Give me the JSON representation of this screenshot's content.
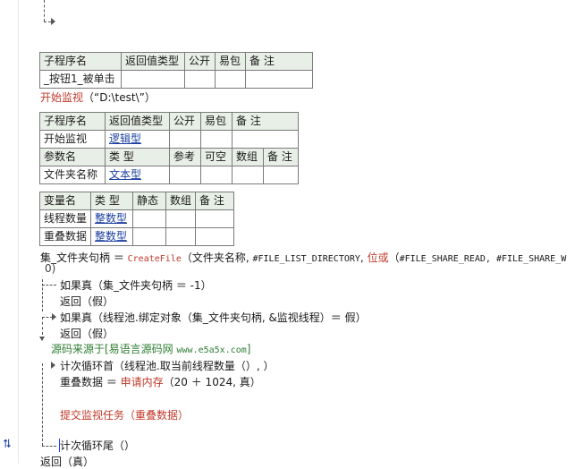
{
  "sub1_table": {
    "headers": [
      "子程序名",
      "返回值类型",
      "公开",
      "易包",
      "备 注"
    ],
    "row": [
      "_按钮1_被单击",
      "",
      "",
      "",
      ""
    ]
  },
  "call_line": {
    "func": "开始监视",
    "args": "（“D:\\test\\”）"
  },
  "sub2_table": {
    "headers": [
      "子程序名",
      "返回值类型",
      "公开",
      "易包",
      "备 注"
    ],
    "row": [
      "开始监视",
      "逻辑型",
      "",
      "",
      ""
    ],
    "param_headers": [
      "参数名",
      "类 型",
      "参考",
      "可空",
      "数组",
      "备 注"
    ],
    "param_row": [
      "文件夹名称",
      "文本型",
      "",
      "",
      "",
      ""
    ]
  },
  "var_table": {
    "headers": [
      "变量名",
      "类 型",
      "静态",
      "数组",
      "备 注"
    ],
    "rows": [
      [
        "线程数量",
        "整数型",
        "",
        "",
        ""
      ],
      [
        "重叠数据",
        "整数型",
        "",
        "",
        ""
      ]
    ]
  },
  "code": {
    "l1_a": "集_文件夹句柄 ＝ ",
    "l1_func": "CreateFile",
    "l1_b": "（文件夹名称, ",
    "l1_const1": "#FILE_LIST_DIRECTORY",
    "l1_c": ", ",
    "l1_func2": "位或",
    "l1_d": "（",
    "l1_const2": "#FILE_SHARE_READ, #FILE_SHARE_W",
    "l1_wrap": "0)",
    "l2": "如果真（集_文件夹句柄 ＝ -1）",
    "l3": "返回（假）",
    "l4": "如果真（线程池.绑定对象（集_文件夹句柄, &监视线程）＝ 假）",
    "l5": "返回（假）",
    "l6_text": "源码来源于[易语言源码网 ",
    "l6_url": "www.e5a5x.com",
    "l6_end": "]",
    "l7": "计次循环首（线程池.取当前线程数量（）, ）",
    "l8_a": "重叠数据 ＝ ",
    "l8_func": "申请内存",
    "l8_b": "（20 ＋ 1024, 真）",
    "l9": "提交监视任务（重叠数据）",
    "l10": "计次循环尾（）",
    "l11": "返回（真）"
  },
  "colors": {
    "header_bg": "#e8efe6",
    "type_blue": "#1b3fa0",
    "func_red": "#c0392b",
    "comment_green": "#2e7d32"
  },
  "icons": {
    "side": "swap-arrows-icon"
  }
}
